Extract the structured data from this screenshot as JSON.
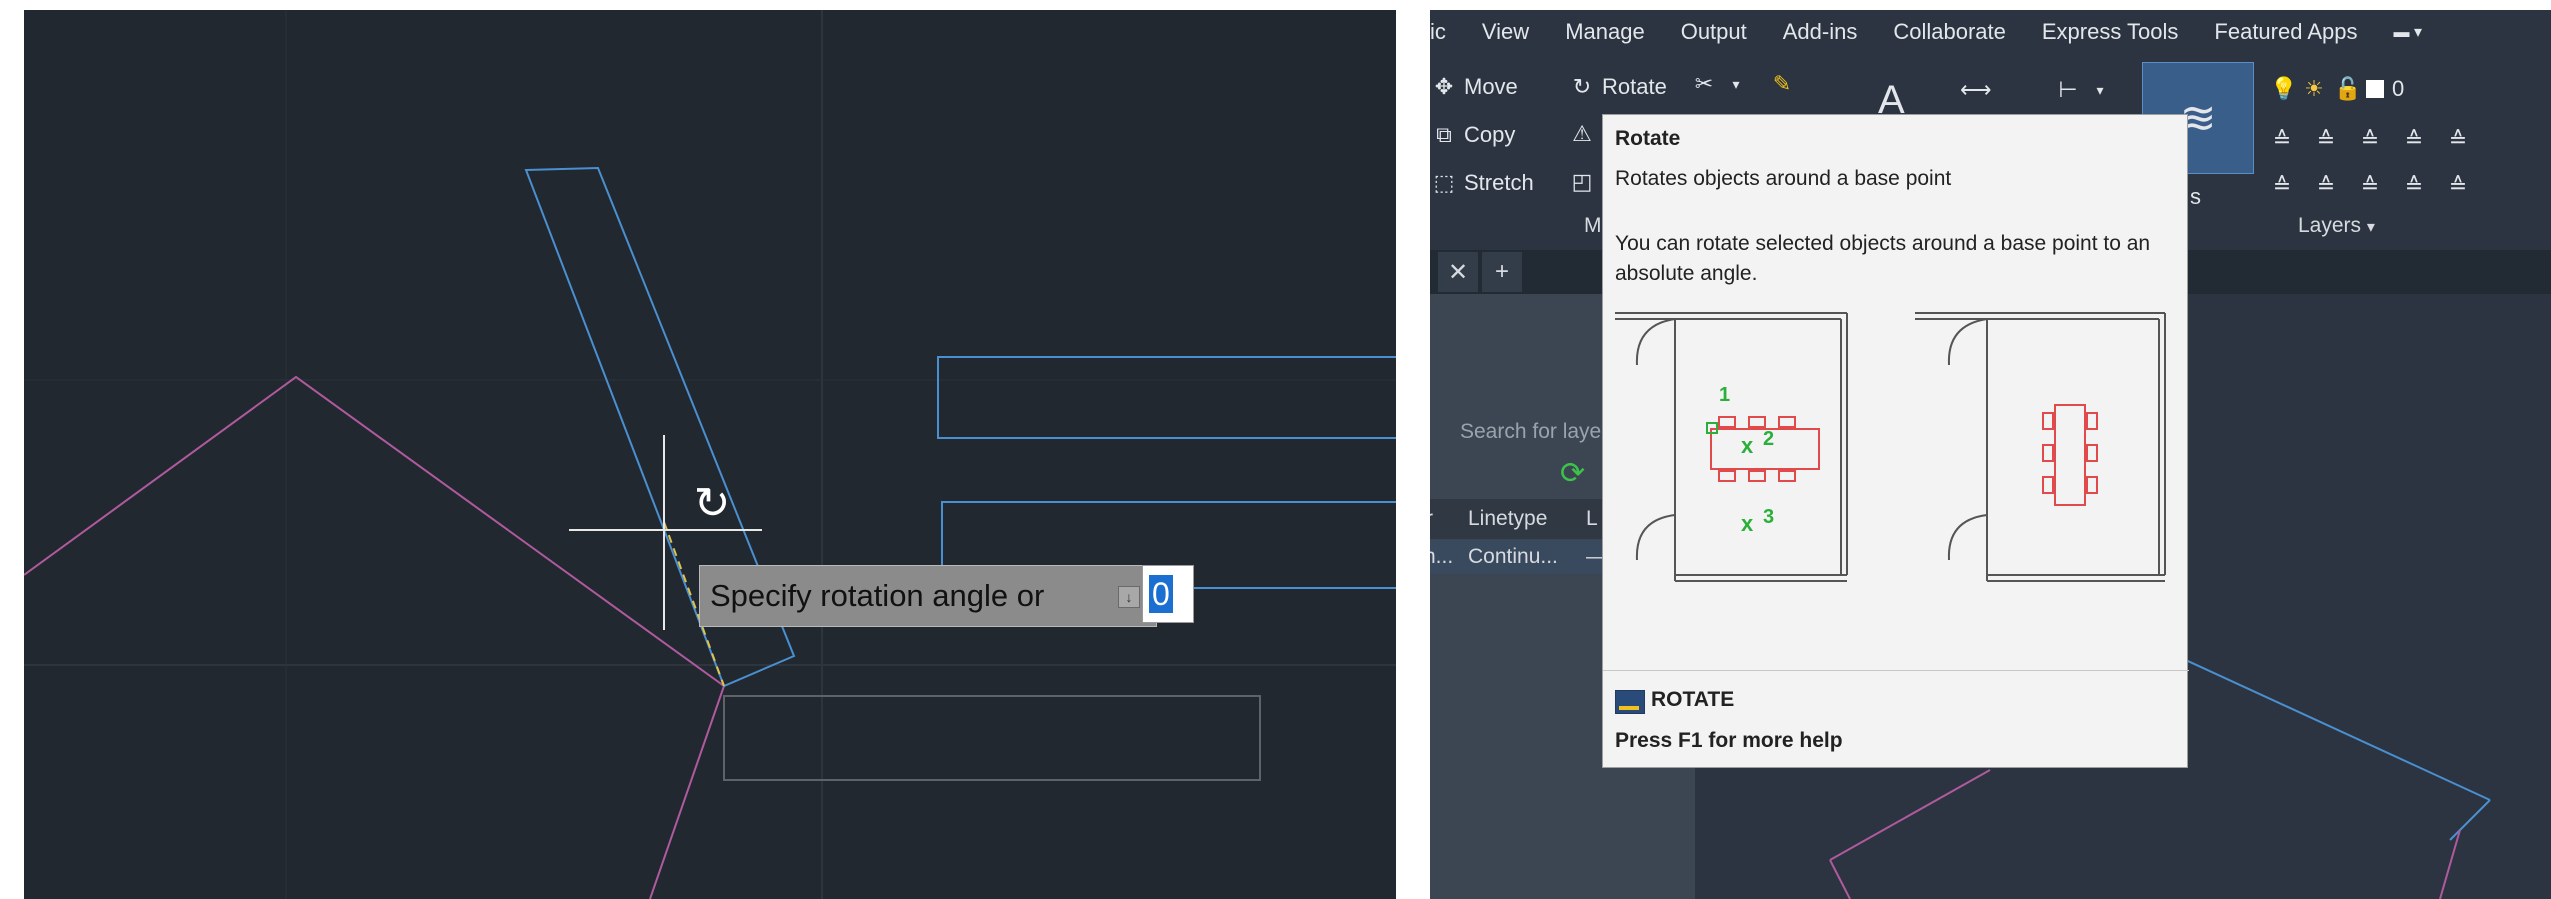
{
  "autocad_view": {
    "prompt": {
      "text": "Specify rotation angle or",
      "angle_value": "0",
      "option_icon": "arrow-down-icon"
    },
    "cursor_icon": "rotate-cursor-icon"
  },
  "ribbon": {
    "menu_tabs": [
      "ic",
      "View",
      "Manage",
      "Output",
      "Add-ins",
      "Collaborate",
      "Express Tools",
      "Featured Apps"
    ],
    "modify": {
      "move": "Move",
      "rotate": "Rotate",
      "copy": "Copy",
      "stretch": "Stretch",
      "panel_title": "Mo"
    },
    "layers": {
      "current_layer": "0",
      "panel_title": "Layers"
    },
    "obscured_label": "s"
  },
  "tabs": {
    "close_symbol": "✕",
    "add_symbol": "+"
  },
  "layer_panel": {
    "search_placeholder": "Search for laye",
    "headers": [
      "r",
      "Linetype",
      "L"
    ],
    "row": [
      "n...",
      "Continu...",
      "—"
    ]
  },
  "tooltip": {
    "title": "Rotate",
    "summary": "Rotates objects around a base point",
    "detail": "You can rotate selected objects around a base point to an absolute angle.",
    "illustration_labels": [
      "1",
      "2",
      "3"
    ],
    "illustration_marks": [
      "x",
      "x"
    ],
    "command": "ROTATE",
    "help": "Press F1 for more help"
  },
  "colors": {
    "canvas_bg": "#212830",
    "ui_bg": "#2b3440",
    "selection_line": "#4a8fd0",
    "magenta_line": "#b05a9e",
    "gray_line": "#6a7076",
    "highlight_blue": "#1b6fd1"
  }
}
